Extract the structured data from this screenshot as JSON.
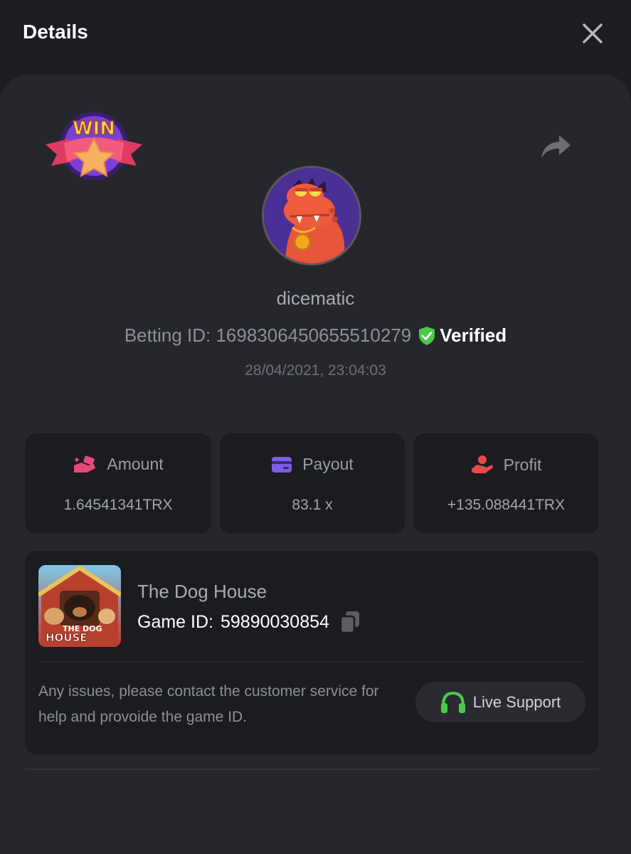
{
  "header": {
    "title": "Details"
  },
  "bet": {
    "badge_text": "WIN",
    "username": "dicematic",
    "betting_id": "Betting ID: 1698306450655510279",
    "verified_label": "Verified",
    "date": "28/04/2021, 23:04:03"
  },
  "stats": [
    {
      "label": "Amount",
      "value": "1.64541341TRX",
      "icon": "money-hand-icon",
      "icon_color": "#e8497a"
    },
    {
      "label": "Payout",
      "value": "83.1 x",
      "icon": "card-icon",
      "icon_color": "#7d5ce8"
    },
    {
      "label": "Profit",
      "value": "+135.088441TRX",
      "icon": "hand-coin-icon",
      "icon_color": "#e84a45"
    }
  ],
  "game": {
    "name": "The Dog House",
    "id_label": "Game ID:",
    "id_value": "59890030854",
    "thumb_text_line1": "THE DOG",
    "thumb_text_line2": "HOUSE",
    "support_text": "Any issues, please contact the customer service for help and provoide the game ID.",
    "support_button": "Live Support"
  },
  "colors": {
    "background": "#1c1d21",
    "panel": "#26272c",
    "card": "#1b1c20",
    "verified_green": "#4cc94a",
    "support_green": "#4cc94a"
  }
}
